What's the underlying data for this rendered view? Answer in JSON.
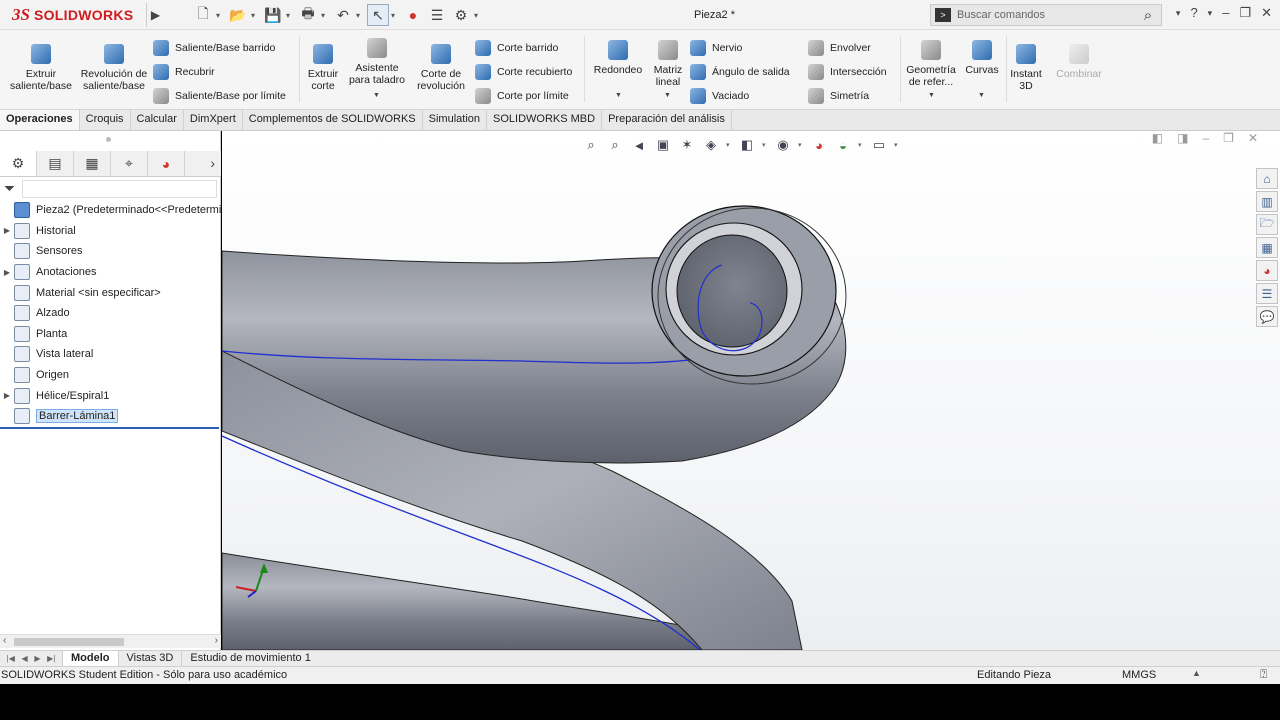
{
  "app": {
    "logo_ds": "3S",
    "logo_name": "SOLIDWORKS",
    "document_title": "Pieza2 *"
  },
  "search": {
    "placeholder": "Buscar comandos"
  },
  "ribbon": {
    "extruir_saliente": "Extruir saliente/base",
    "revolucion_saliente": "Revolución de saliente/base",
    "saliente_barrido": "Saliente/Base barrido",
    "recubrir": "Recubrir",
    "saliente_limite": "Saliente/Base por límite",
    "extruir_corte": "Extruir corte",
    "asistente_taladro": "Asistente para taladro",
    "corte_revolucion": "Corte de revolución",
    "corte_barrido": "Corte barrido",
    "corte_recubierto": "Corte recubierto",
    "corte_limite": "Corte por límite",
    "redondeo": "Redondeo",
    "matriz_lineal": "Matriz lineal",
    "nervio": "Nervio",
    "angulo_salida": "Ángulo de salida",
    "vaciado": "Vaciado",
    "envolver": "Envolver",
    "interseccion": "Intersección",
    "simetria": "Simetría",
    "geometria_referencia": "Geometría de refer...",
    "curvas": "Curvas",
    "instant3d": "Instant 3D",
    "combinar": "Combinar"
  },
  "command_tabs": [
    "Operaciones",
    "Croquis",
    "Calcular",
    "DimXpert",
    "Complementos de SOLIDWORKS",
    "Simulation",
    "SOLIDWORKS MBD",
    "Preparación del análisis"
  ],
  "feature_tree": {
    "root": "Pieza2  (Predeterminado<<Predetermi",
    "items": [
      {
        "label": "Historial",
        "icon": "history-folder-icon"
      },
      {
        "label": "Sensores",
        "icon": "sensor-icon"
      },
      {
        "label": "Anotaciones",
        "icon": "annotations-icon"
      },
      {
        "label": "Material <sin especificar>",
        "icon": "material-icon"
      },
      {
        "label": "Alzado",
        "icon": "plane-icon"
      },
      {
        "label": "Planta",
        "icon": "plane-icon"
      },
      {
        "label": "Vista lateral",
        "icon": "plane-icon"
      },
      {
        "label": "Origen",
        "icon": "origin-icon"
      },
      {
        "label": "Hélice/Espiral1",
        "icon": "helix-icon"
      },
      {
        "label": "Barrer-Lámina1",
        "icon": "sweep-icon"
      }
    ]
  },
  "bottom_tabs": [
    "Modelo",
    "Vistas 3D",
    "Estudio de movimiento 1"
  ],
  "status": {
    "edition": "SOLIDWORKS Student Edition - Sólo para uso académico",
    "mode": "Editando Pieza",
    "units": "MMGS"
  },
  "colors": {
    "brand_red": "#d01c1f",
    "model_gray": "#6f7480",
    "helix_blue": "#1f2fd0",
    "selection_blue": "#2b5fb1"
  }
}
